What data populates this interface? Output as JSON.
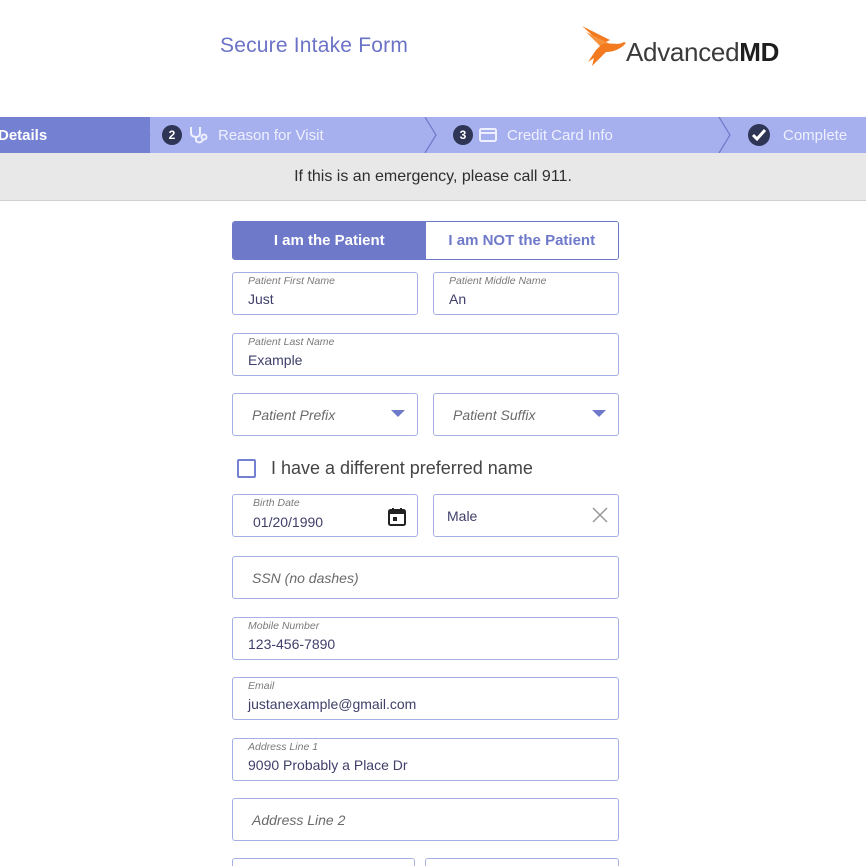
{
  "header": {
    "title": "Secure Intake Form",
    "logo": {
      "text_regular": "Advanced",
      "text_bold": "MD",
      "brand_color": "#f47a1f"
    }
  },
  "stepper": {
    "steps": [
      {
        "label": "Details",
        "state": "active"
      },
      {
        "number": "2",
        "icon": "stethoscope-icon",
        "label": "Reason for Visit"
      },
      {
        "number": "3",
        "icon": "credit-card-icon",
        "label": "Credit Card Info"
      },
      {
        "icon": "check-circle-icon",
        "label": "Complete"
      }
    ]
  },
  "banner": {
    "text": "If this is an emergency, please call 911."
  },
  "toggle": {
    "patient": "I am the Patient",
    "not_patient": "I am NOT the Patient",
    "selected": "patient"
  },
  "form": {
    "first_name": {
      "label": "Patient First Name",
      "value": "Just"
    },
    "middle_name": {
      "label": "Patient Middle Name",
      "value": "An"
    },
    "last_name": {
      "label": "Patient Last Name",
      "value": "Example"
    },
    "prefix": {
      "placeholder": "Patient Prefix"
    },
    "suffix": {
      "placeholder": "Patient Suffix"
    },
    "preferred_name": {
      "label": "I have a different preferred name",
      "checked": false
    },
    "birth_date": {
      "label": "Birth Date",
      "value": "01/20/1990"
    },
    "gender": {
      "value": "Male"
    },
    "ssn": {
      "placeholder": "SSN (no dashes)"
    },
    "mobile": {
      "label": "Mobile Number",
      "value": "123-456-7890"
    },
    "email": {
      "label": "Email",
      "value": "justanexample@gmail.com"
    },
    "address1": {
      "label": "Address Line 1",
      "value": "9090 Probably a Place Dr"
    },
    "address2": {
      "placeholder": "Address Line 2"
    }
  },
  "colors": {
    "accent": "#6f79c9",
    "stepper_bg": "#a6b0ee",
    "stepper_active": "#7480d2",
    "banner_bg": "#e8e8e8"
  }
}
